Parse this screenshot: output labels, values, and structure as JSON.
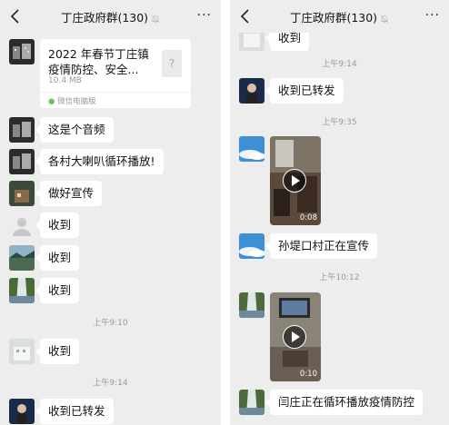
{
  "left": {
    "title": "丁庄政府群(130)",
    "more": "···",
    "file": {
      "name": "2022 年春节丁庄镇疫情防控、安全...",
      "size": "10.4 MB",
      "source": "微信电脑版",
      "icon": "?"
    },
    "messages": [
      "这是个音频",
      "各村大喇叭循环播放!",
      "做好宣传",
      "收到",
      "收到",
      "收到",
      "收到",
      "收到已转发"
    ],
    "times": [
      "上午9:10",
      "上午9:14"
    ]
  },
  "right": {
    "title": "丁庄政府群(130)",
    "more": "···",
    "top_partial": "收到",
    "times": [
      "上午9:14",
      "上午9:35",
      "上午10:12"
    ],
    "forward": "收到已转发",
    "video1_duration": "0:08",
    "sun_msg": "孙堤口村正在宣传",
    "video2_duration": "0:10",
    "yan_msg": "闫庄正在循环播放疫情防控"
  }
}
